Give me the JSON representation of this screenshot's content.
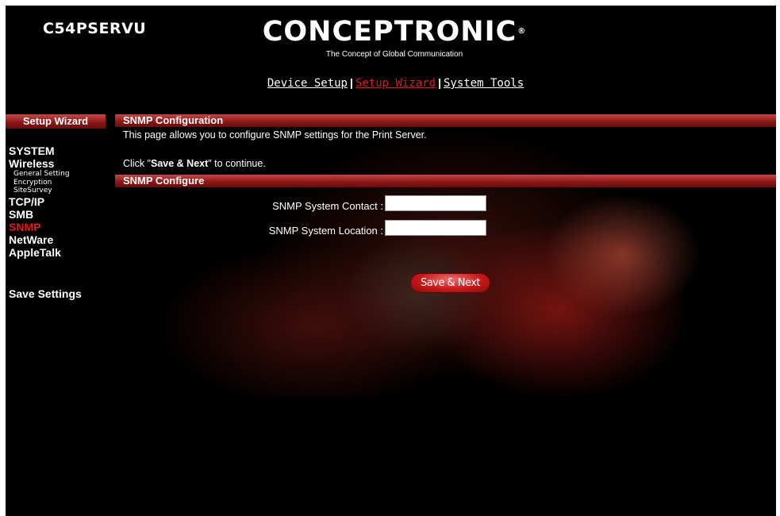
{
  "header": {
    "model": "C54PSERVU",
    "brand": "CONCEPTRONIC",
    "brand_mark": "®",
    "tagline": "The Concept of Global Communication"
  },
  "topnav": {
    "items": [
      {
        "label": "Device Setup",
        "active": false
      },
      {
        "label": "Setup Wizard",
        "active": true
      },
      {
        "label": "System Tools",
        "active": false
      }
    ],
    "separator": "|"
  },
  "sidebar": {
    "title": "Setup Wizard",
    "items": [
      {
        "label": "SYSTEM",
        "type": "main"
      },
      {
        "label": "Wireless",
        "type": "main"
      },
      {
        "label": "General Setting",
        "type": "sub"
      },
      {
        "label": "Encryption",
        "type": "sub"
      },
      {
        "label": "SiteSurvey",
        "type": "sub"
      },
      {
        "label": "TCP/IP",
        "type": "main"
      },
      {
        "label": "SMB",
        "type": "main"
      },
      {
        "label": "SNMP",
        "type": "main",
        "active": true
      },
      {
        "label": "NetWare",
        "type": "main"
      },
      {
        "label": "AppleTalk",
        "type": "main"
      }
    ],
    "save_settings": "Save Settings"
  },
  "main": {
    "section_title": "SNMP Configuration",
    "description": "This page allows you to configure SNMP settings for the Print Server.",
    "click_prefix": "Click \"",
    "click_bold": "Save & Next",
    "click_suffix": "\" to continue.",
    "form_title": "SNMP Configure",
    "contact_label": "SNMP System Contact :",
    "contact_value": "",
    "location_label": "SNMP System Location :",
    "location_value": "",
    "save_next_label": "Save & Next"
  },
  "colors": {
    "background": "#000000",
    "accent_red": "#e01818",
    "bar_red": "#8a1515",
    "text": "#ffffff"
  }
}
